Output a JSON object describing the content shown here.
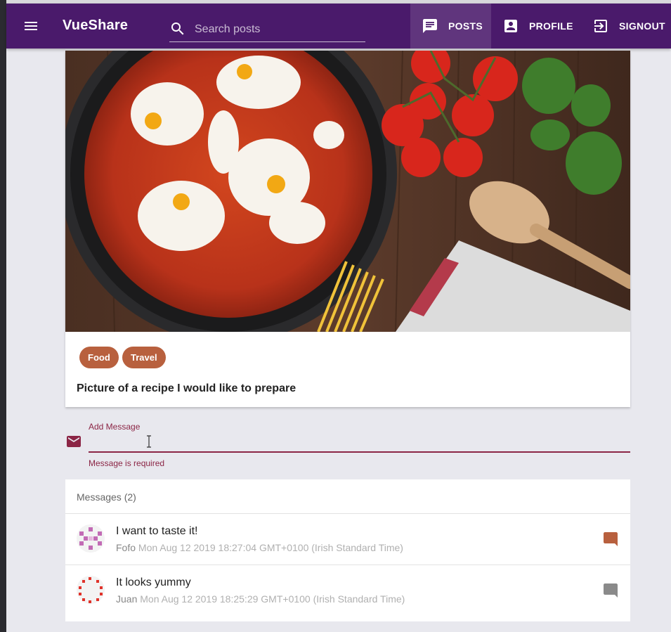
{
  "app": {
    "title": "VueShare"
  },
  "search": {
    "placeholder": "Search posts"
  },
  "nav": [
    {
      "label": "POSTS",
      "icon": "chat-icon",
      "active": true
    },
    {
      "label": "PROFILE",
      "icon": "account-box-icon",
      "active": false
    },
    {
      "label": "SIGNOUT",
      "icon": "exit-icon",
      "active": false
    }
  ],
  "post": {
    "image_alt": "shakshuka pan with tomatoes, basil, spoon and spaghetti",
    "tags": [
      "Food",
      "Travel"
    ],
    "caption": "Picture of a recipe I would like to prepare"
  },
  "message_form": {
    "label": "Add Message",
    "value": "",
    "error": "Message is required"
  },
  "messages": {
    "header": "Messages (2)",
    "items": [
      {
        "text": "I want to taste it!",
        "author": "Fofo",
        "date": "Mon Aug 12 2019 18:27:04 GMT+0100 (Irish Standard Time)",
        "icon_color": "#b8603e",
        "avatar_color": "#c26bb5"
      },
      {
        "text": "It looks yummy",
        "author": "Juan",
        "date": "Mon Aug 12 2019 18:25:29 GMT+0100 (Irish Standard Time)",
        "icon_color": "#8a8a8a",
        "avatar_color": "#e0322a"
      }
    ]
  },
  "colors": {
    "toolbar": "#4a1a6b",
    "chip": "#b8603e",
    "accent": "#8b2545"
  }
}
